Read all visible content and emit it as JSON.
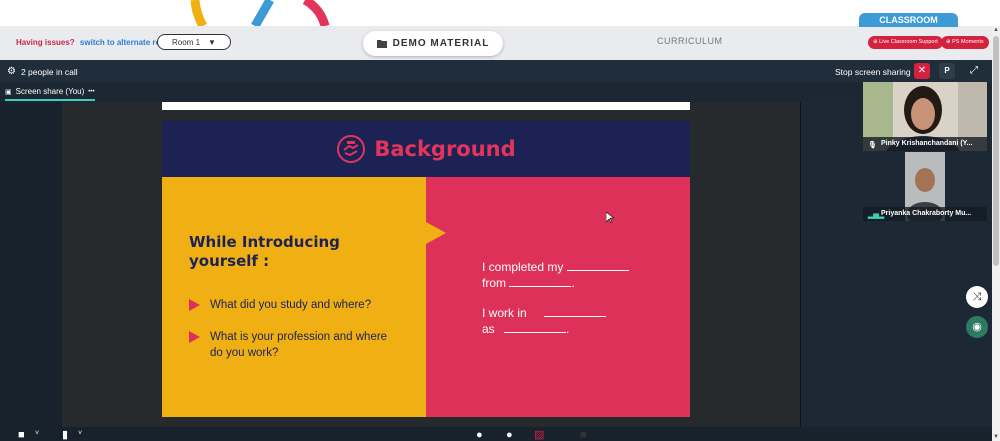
{
  "topbar": {
    "issue_text": "Having issues?",
    "alternate_link": "switch to alternate room",
    "room_value": "Room 1",
    "demo_button": "DEMO MATERIAL",
    "curriculum": "CURRICULUM",
    "classroom_tab": "CLASSROOM",
    "live_support": "Live Classroom Support",
    "ps_moments": "PS Moments"
  },
  "call": {
    "people_count": "2 people in call",
    "stop_sharing": "Stop screen sharing",
    "p_button": "P",
    "share_tab": "Screen share (You)",
    "more": "•••"
  },
  "slide": {
    "title": "Background",
    "intro_title": "While Introducing yourself :",
    "bullets": [
      "What did you study and where?",
      "What is your profession and where do you work?"
    ],
    "line1_a": "I completed my",
    "line1_b": "from",
    "line2_a": "I work in",
    "line2_b": "as",
    "period": "."
  },
  "videos": [
    {
      "name": "Pinky Krishanchandani (Y..."
    },
    {
      "name": "Priyanka Chakraborty Mu..."
    }
  ],
  "colors": {
    "accent_red": "#d3213e",
    "slide_navy": "#1c2254",
    "slide_yellow": "#f0b013",
    "slide_pink": "#dd3159",
    "share_underline": "#3bd0b5"
  }
}
